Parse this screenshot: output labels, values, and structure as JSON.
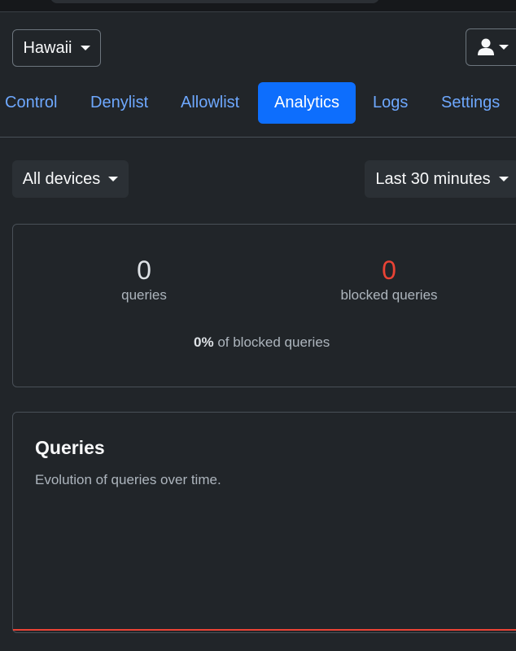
{
  "header": {
    "site_selector": "Hawaii",
    "nav": [
      {
        "label": "Control"
      },
      {
        "label": "Denylist"
      },
      {
        "label": "Allowlist"
      },
      {
        "label": "Analytics",
        "active": true
      },
      {
        "label": "Logs"
      },
      {
        "label": "Settings"
      }
    ]
  },
  "filters": {
    "device": "All devices",
    "time_range": "Last 30 minutes"
  },
  "stats": {
    "queries_value": "0",
    "queries_label": "queries",
    "blocked_value": "0",
    "blocked_label": "blocked queries",
    "percent": "0%",
    "percent_label": "of blocked queries"
  },
  "chart": {
    "title": "Queries",
    "subtitle": "Evolution of queries over time."
  },
  "colors": {
    "accent": "#0d6efd",
    "link": "#6ea8fe",
    "blocked": "#ea4335",
    "background": "#212529"
  }
}
